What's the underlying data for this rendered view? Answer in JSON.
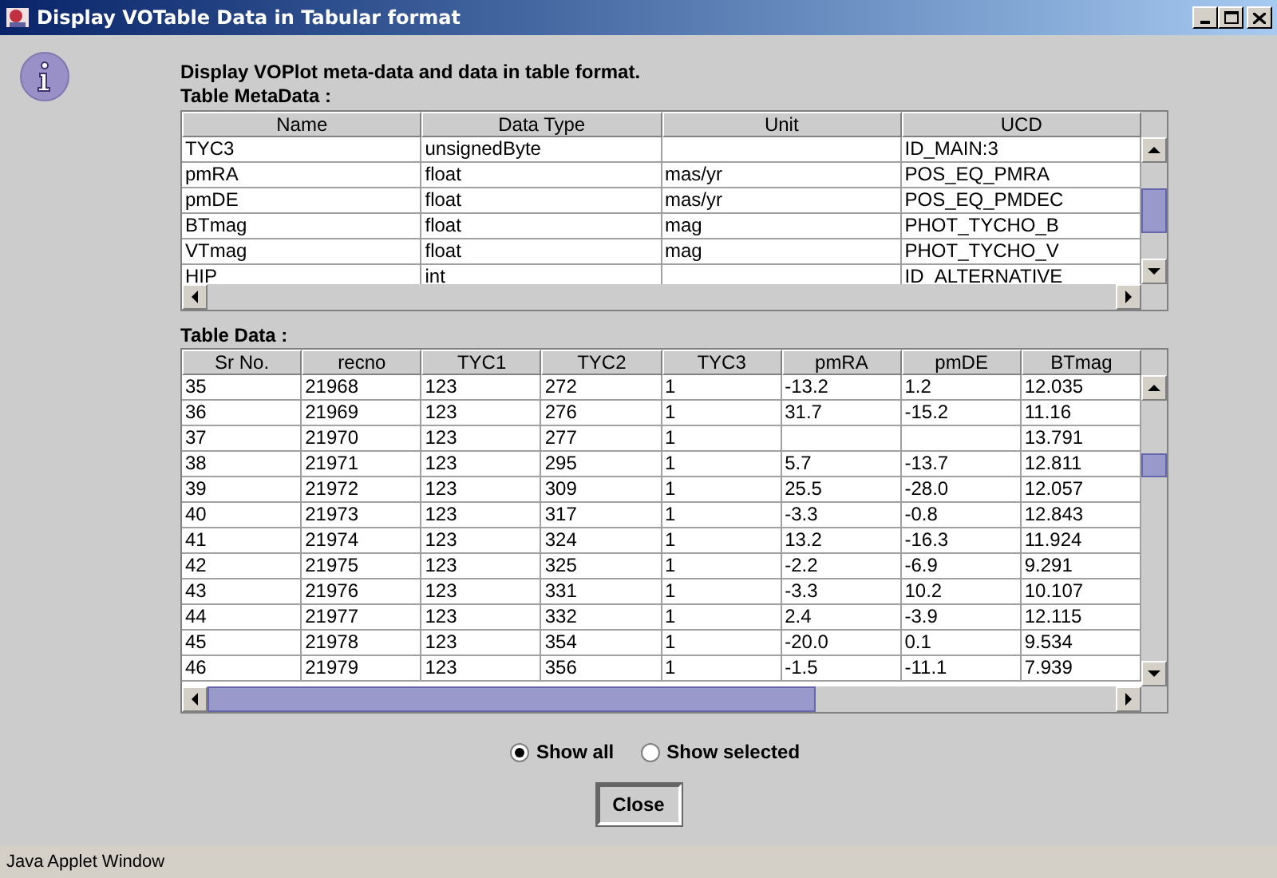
{
  "window": {
    "title": "Display VOTable Data in Tabular format"
  },
  "heading": "Display VOPlot meta-data and data in table format.",
  "meta_label": "Table MetaData :",
  "meta_table": {
    "columns": [
      "Name",
      "Data Type",
      "Unit",
      "UCD"
    ],
    "rows": [
      [
        "TYC3",
        "unsignedByte",
        null,
        "ID_MAIN:3"
      ],
      [
        "pmRA",
        "float",
        "mas/yr",
        "POS_EQ_PMRA"
      ],
      [
        "pmDE",
        "float",
        "mas/yr",
        "POS_EQ_PMDEC"
      ],
      [
        "BTmag",
        "float",
        "mag",
        "PHOT_TYCHO_B"
      ],
      [
        "VTmag",
        "float",
        "mag",
        "PHOT_TYCHO_V"
      ],
      [
        "HIP",
        "int",
        null,
        "ID_ALTERNATIVE"
      ]
    ]
  },
  "data_label": "Table Data :",
  "data_table": {
    "columns": [
      "Sr No.",
      "recno",
      "TYC1",
      "TYC2",
      "TYC3",
      "pmRA",
      "pmDE",
      "BTmag"
    ],
    "rows": [
      [
        "35",
        "21968",
        "123",
        "272",
        "1",
        "-13.2",
        "1.2",
        "12.035"
      ],
      [
        "36",
        "21969",
        "123",
        "276",
        "1",
        "31.7",
        "-15.2",
        "11.16"
      ],
      [
        "37",
        "21970",
        "123",
        "277",
        "1",
        null,
        null,
        "13.791"
      ],
      [
        "38",
        "21971",
        "123",
        "295",
        "1",
        "5.7",
        "-13.7",
        "12.811"
      ],
      [
        "39",
        "21972",
        "123",
        "309",
        "1",
        "25.5",
        "-28.0",
        "12.057"
      ],
      [
        "40",
        "21973",
        "123",
        "317",
        "1",
        "-3.3",
        "-0.8",
        "12.843"
      ],
      [
        "41",
        "21974",
        "123",
        "324",
        "1",
        "13.2",
        "-16.3",
        "11.924"
      ],
      [
        "42",
        "21975",
        "123",
        "325",
        "1",
        "-2.2",
        "-6.9",
        "9.291"
      ],
      [
        "43",
        "21976",
        "123",
        "331",
        "1",
        "-3.3",
        "10.2",
        "10.107"
      ],
      [
        "44",
        "21977",
        "123",
        "332",
        "1",
        "2.4",
        "-3.9",
        "12.115"
      ],
      [
        "45",
        "21978",
        "123",
        "354",
        "1",
        "-20.0",
        "0.1",
        "9.534"
      ],
      [
        "46",
        "21979",
        "123",
        "356",
        "1",
        "-1.5",
        "-11.1",
        "7.939"
      ]
    ]
  },
  "radios": [
    {
      "label": "Show all",
      "selected": true
    },
    {
      "label": "Show selected",
      "selected": false
    }
  ],
  "close_button": "Close",
  "status_bar": "Java Applet Window"
}
